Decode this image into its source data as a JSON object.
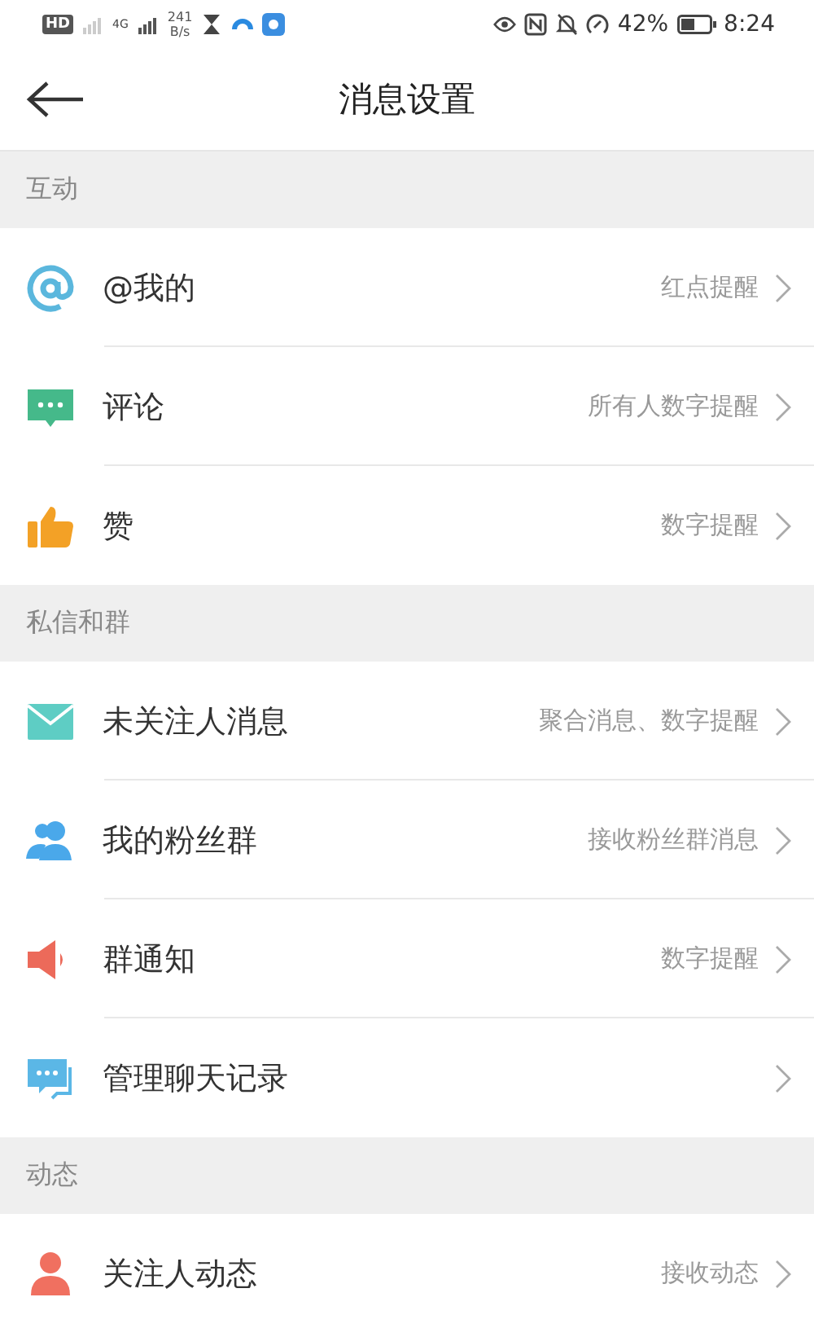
{
  "status_bar": {
    "hd": "HD",
    "network": "4G",
    "speed": "241",
    "speed_unit": "B/s",
    "battery": "42%",
    "time": "8:24"
  },
  "header": {
    "title": "消息设置"
  },
  "sections": [
    {
      "title": "互动",
      "items": [
        {
          "kind": "at",
          "label": "@我的",
          "value": "红点提醒"
        },
        {
          "kind": "comment",
          "label": "评论",
          "value": "所有人数字提醒"
        },
        {
          "kind": "like",
          "label": "赞",
          "value": "数字提醒"
        }
      ]
    },
    {
      "title": "私信和群",
      "items": [
        {
          "kind": "mail",
          "label": "未关注人消息",
          "value": "聚合消息、数字提醒"
        },
        {
          "kind": "group",
          "label": "我的粉丝群",
          "value": "接收粉丝群消息"
        },
        {
          "kind": "speaker",
          "label": "群通知",
          "value": "数字提醒"
        },
        {
          "kind": "chat",
          "label": "管理聊天记录"
        }
      ]
    },
    {
      "title": "动态",
      "items": [
        {
          "kind": "person",
          "label": "关注人动态",
          "value": "接收动态"
        }
      ]
    }
  ]
}
